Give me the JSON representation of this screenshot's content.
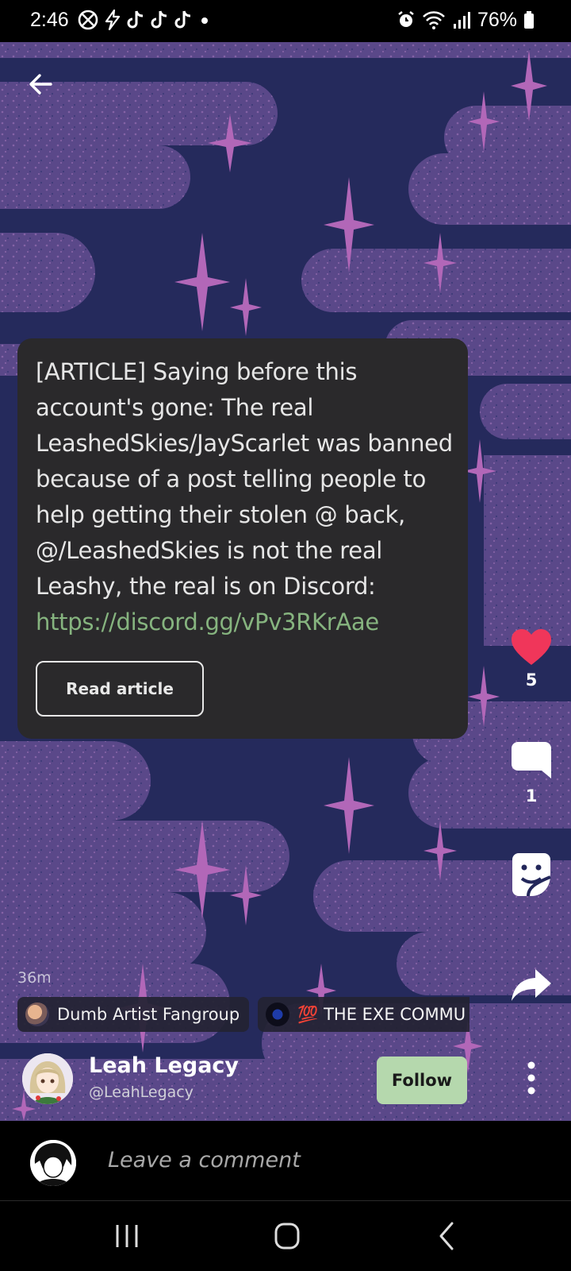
{
  "status_bar": {
    "time": "2:46",
    "battery": "76%",
    "icons": [
      "xbox-icon",
      "bolt-icon",
      "tiktok-icon",
      "tiktok-icon",
      "tiktok-icon",
      "dot-icon",
      "alarm-icon",
      "wifi-icon",
      "signal-icon",
      "battery-icon"
    ]
  },
  "post": {
    "article_text": "[ARTICLE] Saying before this account's gone: The real LeashedSkies/JayScarlet was banned because of a post telling people to help getting their stolen @ back, @/LeashedSkies is not the real Leashy, the real is on Discord: ",
    "article_link": "https://discord.gg/vPv3RKrAae",
    "read_button": "Read article",
    "time_ago": "36m",
    "likes": "5",
    "comments": "1"
  },
  "communities": [
    {
      "name": "Dumb Artist Fangroup"
    },
    {
      "name": "💯 THE EXE COMMU"
    }
  ],
  "author": {
    "name": "Leah Legacy",
    "handle": "@LeahLegacy",
    "follow_label": "Follow"
  },
  "comment_bar": {
    "placeholder": "Leave a comment"
  },
  "colors": {
    "like": "#f0365a",
    "background": "#23275a",
    "stars": "#a45fae",
    "card": "#2a292b",
    "follow": "#b5d8ad",
    "link": "#86b47f"
  }
}
